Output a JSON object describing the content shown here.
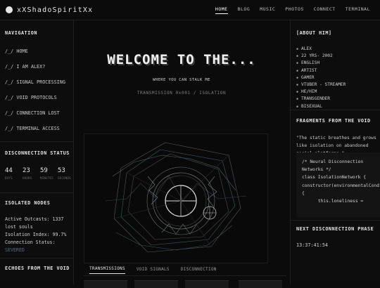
{
  "site": {
    "title": "xXShadoSpiritXx"
  },
  "topnav": [
    "HOME",
    "BLOG",
    "MUSIC",
    "PHOTOS",
    "CONNECT",
    "TERMINAL"
  ],
  "left": {
    "navigation_title": "NAVIGATION",
    "nav_items": [
      "/_/ HOME",
      "/_/ I AM ALEX?",
      "/_/ SIGNAL PROCESSING",
      "/_/ VOID PROTOCOLS",
      "/_/ CONNECTION LOST",
      "/_/ TERMINAL ACCESS"
    ],
    "disconnection_title": "DISCONNECTION STATUS",
    "counters": [
      {
        "value": "44",
        "label": "DAYS"
      },
      {
        "value": "23",
        "label": "HOURS"
      },
      {
        "value": "59",
        "label": "MINUTES"
      },
      {
        "value": "53",
        "label": "SECONDS"
      }
    ],
    "isolated_title": "ISOLATED NODES",
    "isolated_lines": [
      "Active Outcasts: 1337",
      "lost souls",
      "Isolation Index: 99.7%",
      "Connection Status:"
    ],
    "isolated_status": "SEVERED",
    "echoes_title": "ECHOES FROM THE VOID"
  },
  "main": {
    "hero_title": "WELCOME TO THE...",
    "hero_sub": "WHERE YOU CAN STALK ME",
    "transmission": "TRANSMISSION 0x001 / ISOLATION",
    "tabs": [
      "TRANSMISSIONS",
      "VOID SIGNALS",
      "DISCONNECTION"
    ]
  },
  "right": {
    "about_title": "[ABOUT HIM]",
    "about_items": [
      "ALEX",
      "22 YRS- 2002",
      "ENGLISH",
      "ARTIST",
      "GAMER",
      "VTUBER - STREAMER",
      "HE/HIM",
      "TRANSGENDER",
      "BISEXUAL"
    ],
    "fragments_title": "FRAGMENTS FROM THE VOID",
    "quote": "\"The static breathes and grows like isolation on abandoned social platforms.\"",
    "code_lines": [
      "/* Neural Disconnection",
      "Networks */",
      "class IsolationNetwork {",
      "",
      "constructor(environmentalCond",
      "{",
      "      this.loneliness ="
    ],
    "next_title": "NEXT DISCONNECTION PHASE",
    "next_time": "13:37:41:54"
  }
}
